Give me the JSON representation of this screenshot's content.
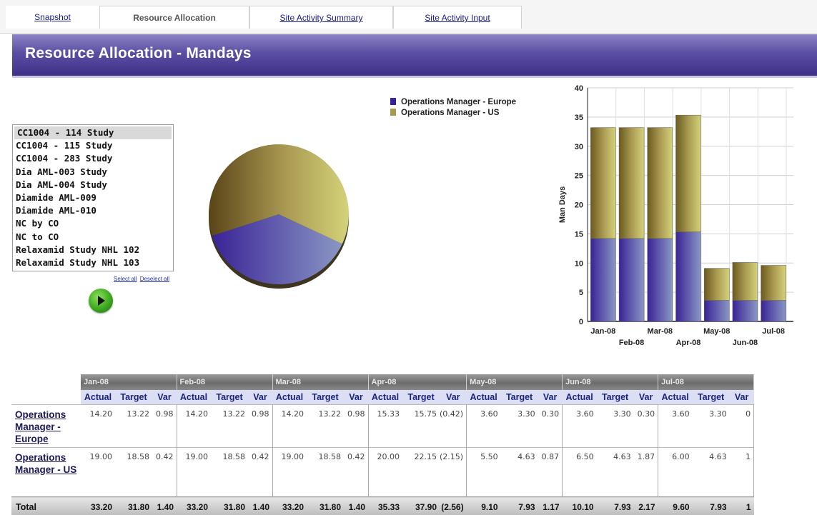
{
  "tabs": [
    {
      "label": "Snapshot",
      "active": false
    },
    {
      "label": "Resource Allocation",
      "active": true
    },
    {
      "label": "Site Activity Summary",
      "active": false
    },
    {
      "label": "Site Activity Input",
      "active": false
    }
  ],
  "header": {
    "title": "Resource Allocation - Mandays"
  },
  "studies": {
    "items": [
      "CC1004 - 114 Study",
      "CC1004 - 115 Study",
      "CC1004 - 283 Study",
      "Dia AML-003 Study",
      "Dia AML-004 Study",
      "Diamide AML-009",
      "Diamide AML-010",
      "NC by CO",
      "NC to CO",
      "Relaxamid Study NHL 102",
      "Relaxamid Study NHL 103"
    ],
    "selected": "CC1004 - 114 Study",
    "select_all": "Select all",
    "deselect_all": "Deselect all"
  },
  "colors": {
    "europe": "#3a2396",
    "us": "#a99a52",
    "europe_light": "#8a97c4",
    "us_light": "#d4d27a"
  },
  "legend": {
    "europe": "Operations Manager - Europe",
    "us": "Operations Manager - US"
  },
  "chart_data": [
    {
      "type": "pie",
      "series": [
        {
          "name": "Operations Manager - Europe",
          "value": 38.1
        },
        {
          "name": "Operations Manager - US",
          "value": 61.9
        }
      ]
    },
    {
      "type": "bar",
      "stacked": true,
      "ylabel": "Man Days",
      "ylim": [
        0,
        40
      ],
      "yticks": [
        0,
        5,
        10,
        15,
        20,
        25,
        30,
        35,
        40
      ],
      "grid": true,
      "categories": [
        "Jan-08",
        "Feb-08",
        "Mar-08",
        "Apr-08",
        "May-08",
        "Jun-08",
        "Jul-08"
      ],
      "series": [
        {
          "name": "Operations Manager - Europe",
          "values": [
            14.2,
            14.2,
            14.2,
            15.33,
            3.6,
            3.6,
            3.6
          ]
        },
        {
          "name": "Operations Manager - US",
          "values": [
            19.0,
            19.0,
            19.0,
            20.0,
            5.5,
            6.5,
            6.0
          ]
        }
      ]
    }
  ],
  "table": {
    "months": [
      "Jan-08",
      "Feb-08",
      "Mar-08",
      "Apr-08",
      "May-08",
      "Jun-08",
      "Jul-08"
    ],
    "subheaders": [
      "Actual",
      "Target",
      "Var"
    ],
    "rows": [
      {
        "label": "Operations Manager - Europe",
        "values": [
          [
            "14.20",
            "13.22",
            "0.98"
          ],
          [
            "14.20",
            "13.22",
            "0.98"
          ],
          [
            "14.20",
            "13.22",
            "0.98"
          ],
          [
            "15.33",
            "15.75",
            "(0.42)"
          ],
          [
            "3.60",
            "3.30",
            "0.30"
          ],
          [
            "3.60",
            "3.30",
            "0.30"
          ],
          [
            "3.60",
            "3.30",
            "0"
          ]
        ]
      },
      {
        "label": "Operations Manager - US",
        "values": [
          [
            "19.00",
            "18.58",
            "0.42"
          ],
          [
            "19.00",
            "18.58",
            "0.42"
          ],
          [
            "19.00",
            "18.58",
            "0.42"
          ],
          [
            "20.00",
            "22.15",
            "(2.15)"
          ],
          [
            "5.50",
            "4.63",
            "0.87"
          ],
          [
            "6.50",
            "4.63",
            "1.87"
          ],
          [
            "6.00",
            "4.63",
            "1"
          ]
        ]
      }
    ],
    "total": {
      "label": "Total",
      "values": [
        [
          "33.20",
          "31.80",
          "1.40"
        ],
        [
          "33.20",
          "31.80",
          "1.40"
        ],
        [
          "33.20",
          "31.80",
          "1.40"
        ],
        [
          "35.33",
          "37.90",
          "(2.56)"
        ],
        [
          "9.10",
          "7.93",
          "1.17"
        ],
        [
          "10.10",
          "7.93",
          "2.17"
        ],
        [
          "9.60",
          "7.93",
          "1"
        ]
      ]
    }
  }
}
